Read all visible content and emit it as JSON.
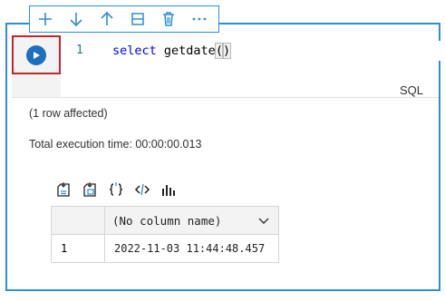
{
  "toolbar": {
    "items": [
      {
        "icon": "plus-icon"
      },
      {
        "icon": "arrow-down-icon"
      },
      {
        "icon": "arrow-up-icon"
      },
      {
        "icon": "split-cell-icon"
      },
      {
        "icon": "trash-icon"
      },
      {
        "icon": "more-icon"
      }
    ]
  },
  "editor": {
    "line_number": "1",
    "code_keyword": "select",
    "code_func": " getdate",
    "code_paren_open": "(",
    "code_paren_close": ")",
    "language": "SQL"
  },
  "output": {
    "rows_affected": "(1 row affected)",
    "execution_time": "Total execution time: 00:00:00.013"
  },
  "result_grid": {
    "column_header": "(No column name)",
    "rows": [
      {
        "row_number": "1",
        "value": "2022-11-03 11:44:48.457"
      }
    ]
  },
  "colors": {
    "accent": "#2b8fd6",
    "run_button": "#1f6fbf",
    "highlight_border": "#c0262a"
  }
}
